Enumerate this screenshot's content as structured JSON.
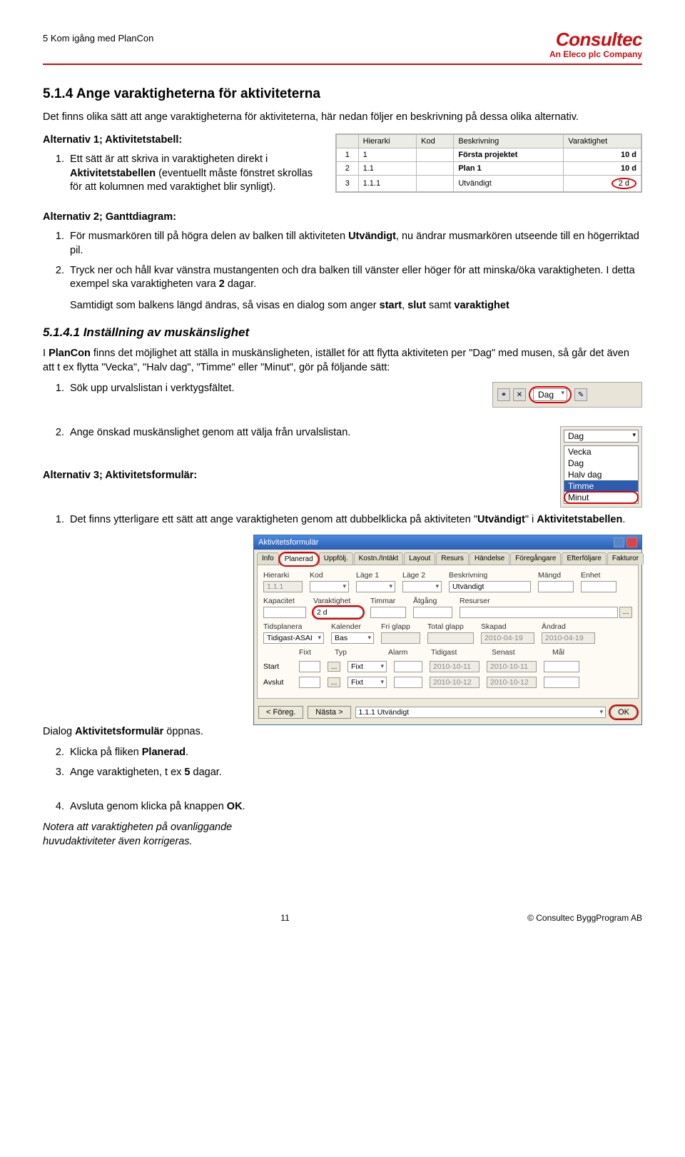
{
  "header": {
    "left": "5 Kom igång med PlanCon",
    "logo": "Consultec",
    "logo_sub": "An Eleco plc Company"
  },
  "h1": "5.1.4  Ange varaktigheterna för aktiviteterna",
  "intro": "Det finns olika sätt att ange varaktigheterna för aktiviteterna, här nedan följer en beskrivning på dessa olika alternativ.",
  "alt1_head": "Alternativ 1; Aktivitetstabell:",
  "alt1_item1_a": "Ett sätt är att skriva in varaktigheten direkt i ",
  "alt1_item1_b": "Aktivitetstabellen",
  "alt1_item1_c": " (eventuellt måste fönstret skrollas för att kolumnen med varaktighet blir synligt).",
  "shot1": {
    "cols": [
      "",
      "Hierarki",
      "Kod",
      "Beskrivning",
      "Varaktighet"
    ],
    "rows": [
      [
        "1",
        "1",
        "",
        "Första projektet",
        "10 d"
      ],
      [
        "2",
        "1.1",
        "",
        "Plan 1",
        "10 d"
      ],
      [
        "3",
        "1.1.1",
        "",
        "Utvändigt",
        "2 d"
      ]
    ]
  },
  "alt2_head": "Alternativ 2; Ganttdiagram:",
  "alt2_item1_a": "För musmarkören till på högra delen av balken till aktiviteten ",
  "alt2_item1_b": "Utvändigt",
  "alt2_item1_c": ", nu ändrar musmarkören utseende till en högerriktad pil.",
  "alt2_item2_a": "Tryck ner och håll kvar vänstra mustangenten och dra balken till vänster eller höger för att minska/öka varaktigheten. I detta exempel ska varaktigheten vara ",
  "alt2_item2_b": "2",
  "alt2_item2_c": " dagar.",
  "alt2_para_a": "Samtidigt som balkens längd ändras, så visas en dialog som anger ",
  "alt2_para_b": "start",
  "alt2_para_c": ", ",
  "alt2_para_d": "slut",
  "alt2_para_e": " samt ",
  "alt2_para_f": "varaktighet",
  "h2": "5.1.4.1  Inställning av muskänslighet",
  "p2_a": "I ",
  "p2_b": "PlanCon",
  "p2_c": " finns det möjlighet att ställa in muskänsligheten, istället för att flytta aktiviteten per \"Dag\" med musen, så går det även att t ex flytta \"Vecka\", \"Halv dag\", \"Timme\" eller \"Minut\", gör på följande sätt:",
  "step1": "Sök upp urvalslistan i verktygsfältet.",
  "toolbar_sel": "Dag",
  "step2": "Ange önskad muskänslighet genom att välja från urvalslistan.",
  "dd_sel": "Dag",
  "dd_opts": [
    "Vecka",
    "Dag",
    "Halv dag",
    "Timme",
    "Minut"
  ],
  "alt3_head": "Alternativ 3; Aktivitetsformulär:",
  "alt3_item1_a": "Det finns ytterligare ett sätt att ange varaktigheten genom att dubbelklicka på aktiviteten \"",
  "alt3_item1_b": "Utvändigt",
  "alt3_item1_c": "\" i ",
  "alt3_item1_d": "Aktivitetstabellen",
  "alt3_item1_e": ".",
  "dialog_opens_a": "Dialog ",
  "dialog_opens_b": "Aktivitetsformulär",
  "dialog_opens_c": " öppnas.",
  "dlg": {
    "title": "Aktivitetsformulär",
    "tabs": [
      "Info",
      "Planerad",
      "Uppfölj.",
      "Kostn./Intäkt",
      "Layout",
      "Resurs",
      "Händelse",
      "Föregångare",
      "Efterföljare",
      "Fakturor"
    ],
    "f_hierarki_l": "Hierarki",
    "f_hierarki_v": "1.1.1",
    "f_kod_l": "Kod",
    "f_kod_v": "",
    "f_lage1_l": "Läge 1",
    "f_lage1_v": "",
    "f_lage2_l": "Läge 2",
    "f_lage2_v": "",
    "f_beskr_l": "Beskrivning",
    "f_beskr_v": "Utvändigt",
    "f_mangd_l": "Mängd",
    "f_mangd_v": "",
    "f_enhet_l": "Enhet",
    "f_enhet_v": "",
    "f_kap_l": "Kapacitet",
    "f_kap_v": "",
    "f_var_l": "Varaktighet",
    "f_var_v": "2 d",
    "f_tim_l": "Timmar",
    "f_tim_v": "",
    "f_atg_l": "Åtgång",
    "f_atg_v": "",
    "f_res_l": "Resurser",
    "f_res_v": "",
    "f_tidspl_l": "Tidsplanera",
    "f_tidspl_v": "Tidigast-ASAI",
    "f_kal_l": "Kalender",
    "f_kal_v": "Bas",
    "f_fri_l": "Fri glapp",
    "f_fri_v": "",
    "f_tot_l": "Total glapp",
    "f_tot_v": "",
    "f_skap_l": "Skapad",
    "f_skap_v": "2010-04-19",
    "f_andr_l": "Ändrad",
    "f_andr_v": "2010-04-19",
    "f_fixt_l": "Fixt",
    "f_typ_l": "Typ",
    "f_alarm_l": "Alarm",
    "f_tid_l": "Tidigast",
    "f_sen_l": "Senast",
    "f_mal_l": "Mål",
    "f_start_l": "Start",
    "f_start_typ": "Fixt",
    "f_start_tid": "2010-10-11",
    "f_start_sen": "2010-10-11",
    "f_avsl_l": "Avslut",
    "f_avsl_typ": "Fixt",
    "f_avsl_tid": "2010-10-12",
    "f_avsl_sen": "2010-10-12",
    "btn_prev": "< Föreg.",
    "btn_next": "Nästa >",
    "nav_sel": "1.1.1  Utvändigt",
    "btn_ok": "OK",
    "dots": "..."
  },
  "d_step2_a": "Klicka på fliken ",
  "d_step2_b": "Planerad",
  "d_step2_c": ".",
  "d_step3_a": "Ange varaktigheten, t ex ",
  "d_step3_b": "5",
  "d_step3_c": " dagar.",
  "d_step4_a": "Avsluta genom klicka på knappen ",
  "d_step4_b": "OK",
  "d_step4_c": ".",
  "note": "Notera att varaktigheten på ovanliggande huvudaktiviteter även korrigeras.",
  "footer": {
    "page": "11",
    "copy": "© Consultec ByggProgram AB"
  }
}
